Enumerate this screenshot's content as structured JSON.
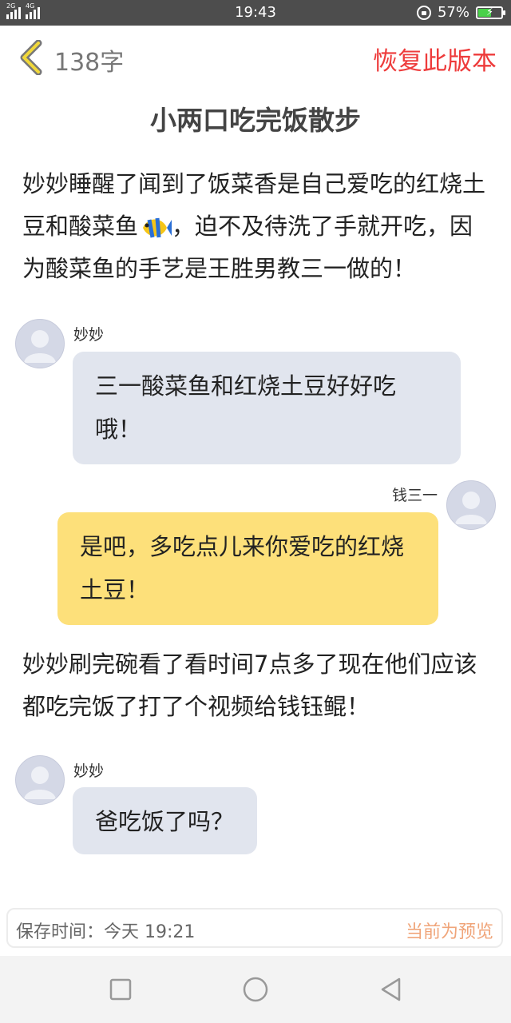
{
  "status_bar": {
    "net1": "2G",
    "net2": "4G",
    "time": "19:43",
    "battery": "57%",
    "battery_level": 0.57
  },
  "header": {
    "word_count": "138字",
    "restore_label": "恢复此版本"
  },
  "title": "小两口吃完饭散步",
  "paragraphs": {
    "p1_a": "妙妙睡醒了闻到了饭菜香是自己爱吃的红烧土豆和酸菜鱼",
    "p1_b": "，迫不及待洗了手就开吃，因为酸菜鱼的手艺是王胜男教三一做的！",
    "p2": "妙妙刷完碗看了看时间7点多了现在他们应该都吃完饭了打了个视频给钱钰鲲！"
  },
  "messages": [
    {
      "sender": "妙妙",
      "text": "三一酸菜鱼和红烧土豆好好吃哦！"
    },
    {
      "sender": "钱三一",
      "text": "是吧，多吃点儿来你爱吃的红烧土豆！"
    },
    {
      "sender": "妙妙",
      "text": "爸吃饭了吗？"
    }
  ],
  "footer": {
    "save_time": "保存时间：今天 19:21",
    "preview_label": "当前为预览"
  },
  "colors": {
    "accent_red": "#ee3b3b",
    "left_bubble": "#e1e5ee",
    "right_bubble": "#fde07a",
    "preview_orange": "#f0a57a"
  }
}
